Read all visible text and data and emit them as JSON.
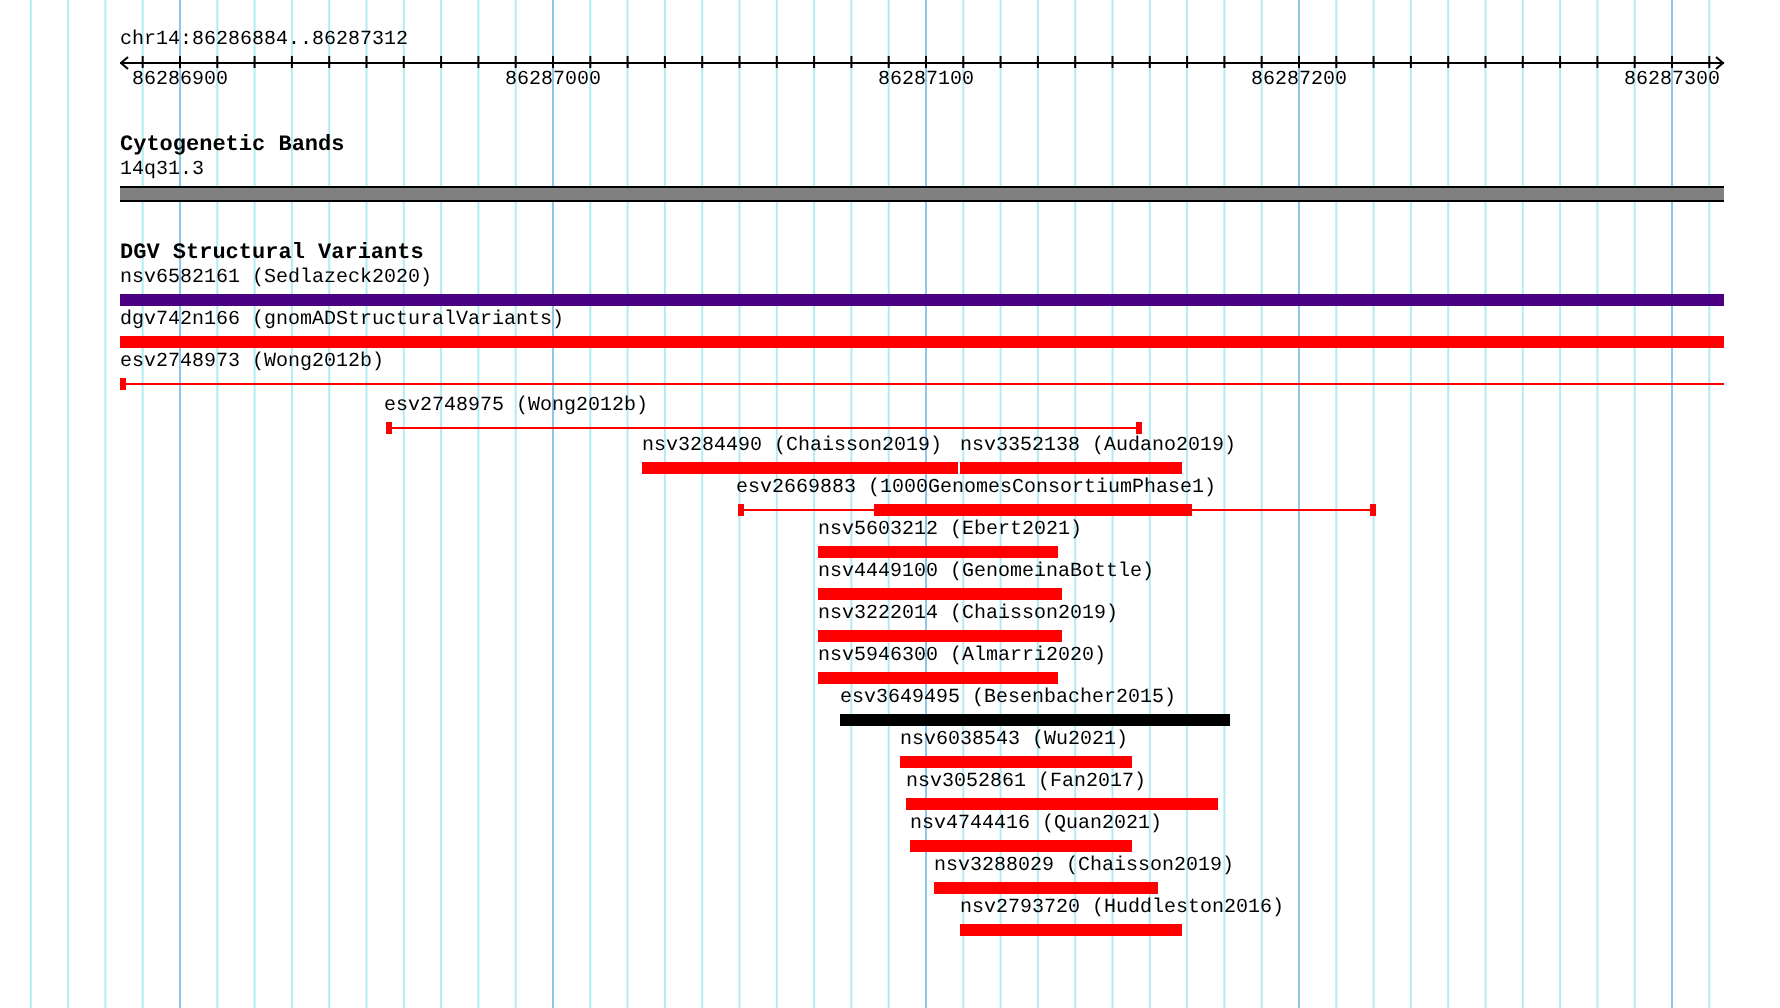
{
  "ruler": {
    "location": "chr14:86286884..86287312",
    "ticks": [
      "86286900",
      "86287000",
      "86287100",
      "86287200",
      "86287300"
    ]
  },
  "cytogenetic_track": {
    "title": "Cytogenetic Bands",
    "band_label": "14q31.3"
  },
  "dgv_track": {
    "title": "DGV Structural Variants",
    "features": [
      {
        "label": "nsv6582161 (Sedlazeck2020)",
        "kind": "block",
        "color": "#4b0082"
      },
      {
        "label": "dgv742n166 (gnomADStructuralVariants)",
        "kind": "block",
        "color": "#ff0000"
      },
      {
        "label": "esv2748973 (Wong2012b)",
        "kind": "span",
        "color": "#ff0000"
      },
      {
        "label": "esv2748975 (Wong2012b)",
        "kind": "span",
        "color": "#ff0000"
      },
      {
        "label": "nsv3284490 (Chaisson2019)",
        "kind": "block",
        "color": "#ff0000"
      },
      {
        "label": "nsv3352138 (Audano2019)",
        "kind": "block",
        "color": "#ff0000"
      },
      {
        "label": "esv2669883 (1000GenomesConsortiumPhase1)",
        "kind": "span_block",
        "color": "#ff0000"
      },
      {
        "label": "nsv5603212 (Ebert2021)",
        "kind": "block",
        "color": "#ff0000"
      },
      {
        "label": "nsv4449100 (GenomeinaBottle)",
        "kind": "block",
        "color": "#ff0000"
      },
      {
        "label": "nsv3222014 (Chaisson2019)",
        "kind": "block",
        "color": "#ff0000"
      },
      {
        "label": "nsv5946300 (Almarri2020)",
        "kind": "block",
        "color": "#ff0000"
      },
      {
        "label": "esv3649495 (Besenbacher2015)",
        "kind": "block",
        "color": "#000000"
      },
      {
        "label": "nsv6038543 (Wu2021)",
        "kind": "block",
        "color": "#ff0000"
      },
      {
        "label": "nsv3052861 (Fan2017)",
        "kind": "block",
        "color": "#ff0000"
      },
      {
        "label": "nsv4744416 (Quan2021)",
        "kind": "block",
        "color": "#ff0000"
      },
      {
        "label": "nsv3288029 (Chaisson2019)",
        "kind": "block",
        "color": "#ff0000"
      },
      {
        "label": "nsv2793720 (Huddleston2016)",
        "kind": "block",
        "color": "#ff0000"
      }
    ]
  }
}
